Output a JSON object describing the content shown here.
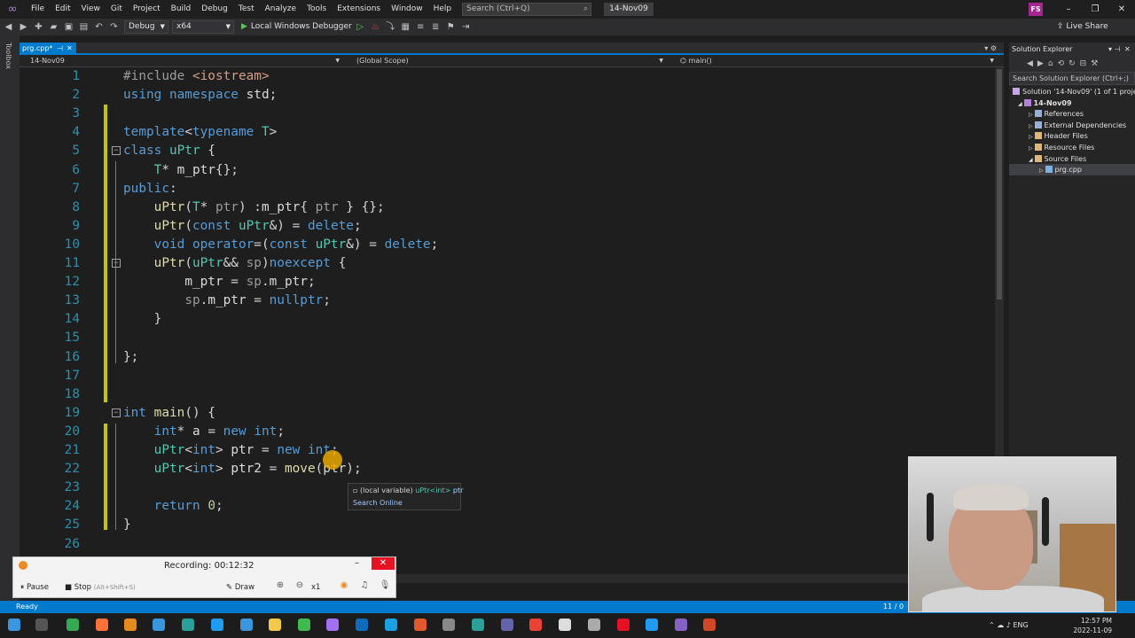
{
  "menu": [
    "File",
    "Edit",
    "View",
    "Git",
    "Project",
    "Build",
    "Debug",
    "Test",
    "Analyze",
    "Tools",
    "Extensions",
    "Window",
    "Help"
  ],
  "search": {
    "placeholder": "Search (Ctrl+Q)"
  },
  "solution_badge": "14-Nov09",
  "user_initials": "FS",
  "toolbar": {
    "config": "Debug",
    "platform": "x64",
    "run_label": "Local Windows Debugger",
    "live_share": "Live Share"
  },
  "toolbox_label": "Toolbox",
  "document_tab": {
    "name": "prg.cpp*"
  },
  "navbar": {
    "project": "14-Nov09",
    "scope": "(Global Scope)",
    "member": "main()"
  },
  "code_lines": [
    {
      "n": "1",
      "tokens": [
        {
          "t": "#include ",
          "c": "pp"
        },
        {
          "t": "<iostream>",
          "c": "str"
        }
      ]
    },
    {
      "n": "2",
      "tokens": [
        {
          "t": "using namespace ",
          "c": "kw"
        },
        {
          "t": "std",
          "c": "id"
        },
        {
          "t": ";",
          "c": "p"
        }
      ]
    },
    {
      "n": "3",
      "tokens": []
    },
    {
      "n": "4",
      "tokens": [
        {
          "t": "template",
          "c": "kw"
        },
        {
          "t": "<",
          "c": "p"
        },
        {
          "t": "typename ",
          "c": "kw"
        },
        {
          "t": "T",
          "c": "ty"
        },
        {
          "t": ">",
          "c": "p"
        }
      ]
    },
    {
      "n": "5",
      "tokens": [
        {
          "t": "class ",
          "c": "kw"
        },
        {
          "t": "uPtr",
          "c": "ty"
        },
        {
          "t": " {",
          "c": "p"
        }
      ]
    },
    {
      "n": "6",
      "tokens": [
        {
          "t": "    ",
          "c": "p"
        },
        {
          "t": "T",
          "c": "ty"
        },
        {
          "t": "* ",
          "c": "p"
        },
        {
          "t": "m_ptr",
          "c": "id"
        },
        {
          "t": "{};",
          "c": "p"
        }
      ]
    },
    {
      "n": "7",
      "tokens": [
        {
          "t": "public",
          "c": "kw"
        },
        {
          "t": ":",
          "c": "p"
        }
      ]
    },
    {
      "n": "8",
      "tokens": [
        {
          "t": "    ",
          "c": "p"
        },
        {
          "t": "uPtr",
          "c": "fn"
        },
        {
          "t": "(",
          "c": "p"
        },
        {
          "t": "T",
          "c": "ty"
        },
        {
          "t": "* ",
          "c": "p"
        },
        {
          "t": "ptr",
          "c": "prm"
        },
        {
          "t": ") :",
          "c": "p"
        },
        {
          "t": "m_ptr",
          "c": "id"
        },
        {
          "t": "{ ",
          "c": "p"
        },
        {
          "t": "ptr",
          "c": "prm"
        },
        {
          "t": " } {};",
          "c": "p"
        }
      ]
    },
    {
      "n": "9",
      "tokens": [
        {
          "t": "    ",
          "c": "p"
        },
        {
          "t": "uPtr",
          "c": "fn"
        },
        {
          "t": "(",
          "c": "p"
        },
        {
          "t": "const ",
          "c": "kw"
        },
        {
          "t": "uPtr",
          "c": "ty"
        },
        {
          "t": "&) = ",
          "c": "p"
        },
        {
          "t": "delete",
          "c": "kw"
        },
        {
          "t": ";",
          "c": "p"
        }
      ]
    },
    {
      "n": "10",
      "tokens": [
        {
          "t": "    ",
          "c": "p"
        },
        {
          "t": "void ",
          "c": "kw"
        },
        {
          "t": "operator",
          "c": "kw"
        },
        {
          "t": "=(",
          "c": "p"
        },
        {
          "t": "const ",
          "c": "kw"
        },
        {
          "t": "uPtr",
          "c": "ty"
        },
        {
          "t": "&) = ",
          "c": "p"
        },
        {
          "t": "delete",
          "c": "kw"
        },
        {
          "t": ";",
          "c": "p"
        }
      ]
    },
    {
      "n": "11",
      "tokens": [
        {
          "t": "    ",
          "c": "p"
        },
        {
          "t": "uPtr",
          "c": "fn"
        },
        {
          "t": "(",
          "c": "p"
        },
        {
          "t": "uPtr",
          "c": "ty"
        },
        {
          "t": "&& ",
          "c": "p"
        },
        {
          "t": "sp",
          "c": "prm"
        },
        {
          "t": ")",
          "c": "p"
        },
        {
          "t": "noexcept",
          "c": "kw"
        },
        {
          "t": " {",
          "c": "p"
        }
      ]
    },
    {
      "n": "12",
      "tokens": [
        {
          "t": "        ",
          "c": "p"
        },
        {
          "t": "m_ptr",
          "c": "id"
        },
        {
          "t": " = ",
          "c": "p"
        },
        {
          "t": "sp",
          "c": "prm"
        },
        {
          "t": ".",
          "c": "p"
        },
        {
          "t": "m_ptr",
          "c": "id"
        },
        {
          "t": ";",
          "c": "p"
        }
      ]
    },
    {
      "n": "13",
      "tokens": [
        {
          "t": "        ",
          "c": "p"
        },
        {
          "t": "sp",
          "c": "prm"
        },
        {
          "t": ".",
          "c": "p"
        },
        {
          "t": "m_ptr",
          "c": "id"
        },
        {
          "t": " = ",
          "c": "p"
        },
        {
          "t": "nullptr",
          "c": "kw"
        },
        {
          "t": ";",
          "c": "p"
        }
      ]
    },
    {
      "n": "14",
      "tokens": [
        {
          "t": "    }",
          "c": "p"
        }
      ]
    },
    {
      "n": "15",
      "tokens": []
    },
    {
      "n": "16",
      "tokens": [
        {
          "t": "};",
          "c": "p"
        }
      ]
    },
    {
      "n": "17",
      "tokens": []
    },
    {
      "n": "18",
      "tokens": []
    },
    {
      "n": "19",
      "tokens": [
        {
          "t": "int ",
          "c": "kw"
        },
        {
          "t": "main",
          "c": "fn"
        },
        {
          "t": "() {",
          "c": "p"
        }
      ]
    },
    {
      "n": "20",
      "tokens": [
        {
          "t": "    ",
          "c": "p"
        },
        {
          "t": "int",
          "c": "kw"
        },
        {
          "t": "* ",
          "c": "p"
        },
        {
          "t": "a",
          "c": "id"
        },
        {
          "t": " = ",
          "c": "p"
        },
        {
          "t": "new ",
          "c": "kw"
        },
        {
          "t": "int",
          "c": "kw"
        },
        {
          "t": ";",
          "c": "p"
        }
      ]
    },
    {
      "n": "21",
      "tokens": [
        {
          "t": "    ",
          "c": "p"
        },
        {
          "t": "uPtr",
          "c": "ty"
        },
        {
          "t": "<",
          "c": "p"
        },
        {
          "t": "int",
          "c": "kw"
        },
        {
          "t": "> ",
          "c": "p"
        },
        {
          "t": "ptr",
          "c": "id"
        },
        {
          "t": " = ",
          "c": "p"
        },
        {
          "t": "new ",
          "c": "kw"
        },
        {
          "t": "int",
          "c": "kw"
        },
        {
          "t": ";",
          "c": "p"
        }
      ]
    },
    {
      "n": "22",
      "tokens": [
        {
          "t": "    ",
          "c": "p"
        },
        {
          "t": "uPtr",
          "c": "ty"
        },
        {
          "t": "<",
          "c": "p"
        },
        {
          "t": "int",
          "c": "kw"
        },
        {
          "t": "> ",
          "c": "p"
        },
        {
          "t": "ptr2",
          "c": "id"
        },
        {
          "t": " = ",
          "c": "p"
        },
        {
          "t": "move",
          "c": "fn"
        },
        {
          "t": "(",
          "c": "p"
        },
        {
          "t": "ptr",
          "c": "id"
        },
        {
          "t": ");",
          "c": "p"
        }
      ]
    },
    {
      "n": "23",
      "tokens": []
    },
    {
      "n": "24",
      "tokens": [
        {
          "t": "    ",
          "c": "p"
        },
        {
          "t": "return ",
          "c": "kw"
        },
        {
          "t": "0",
          "c": "num"
        },
        {
          "t": ";",
          "c": "p"
        }
      ]
    },
    {
      "n": "25",
      "tokens": [
        {
          "t": "}",
          "c": "p"
        }
      ]
    },
    {
      "n": "26",
      "tokens": []
    }
  ],
  "syntax_colors": {
    "kw": "#569cd6",
    "ty": "#4ec9b0",
    "fn": "#dcdcaa",
    "id": "#dadada",
    "prm": "#9a9a9a",
    "str": "#d69d85",
    "pp": "#9b9b9b",
    "num": "#b5cea8",
    "p": "#d4d4d4",
    "linenum": "#2b91af",
    "change": "#c9c400"
  },
  "tooltip": {
    "prefix": "(local variable) ",
    "type": "uPtr<int>",
    "name": " ptr",
    "action": "Search Online"
  },
  "solution_explorer": {
    "title": "Solution Explorer",
    "search_placeholder": "Search Solution Explorer (Ctrl+;)",
    "items": [
      {
        "label": "Solution '14-Nov09' (1 of 1 project)",
        "icon": "solution-icon"
      },
      {
        "label": "14-Nov09",
        "icon": "project-icon"
      },
      {
        "label": "References",
        "icon": "references-icon"
      },
      {
        "label": "External Dependencies",
        "icon": "external-deps-icon"
      },
      {
        "label": "Header Files",
        "icon": "folder-icon"
      },
      {
        "label": "Resource Files",
        "icon": "folder-icon"
      },
      {
        "label": "Source Files",
        "icon": "folder-icon"
      },
      {
        "label": "prg.cpp",
        "icon": "cpp-file-icon"
      }
    ]
  },
  "status": {
    "text": "Ready",
    "position": "11 / 0"
  },
  "recorder": {
    "label": "Recording:",
    "time": "00:12:32",
    "pause": "Pause",
    "stop": "Stop",
    "stop_hint": "(Alt+Shift+S)",
    "draw": "Draw",
    "zoom": "x1"
  },
  "tray": {
    "lang": "ENG",
    "time": "12:57 PM",
    "date": "2022-11-09"
  }
}
